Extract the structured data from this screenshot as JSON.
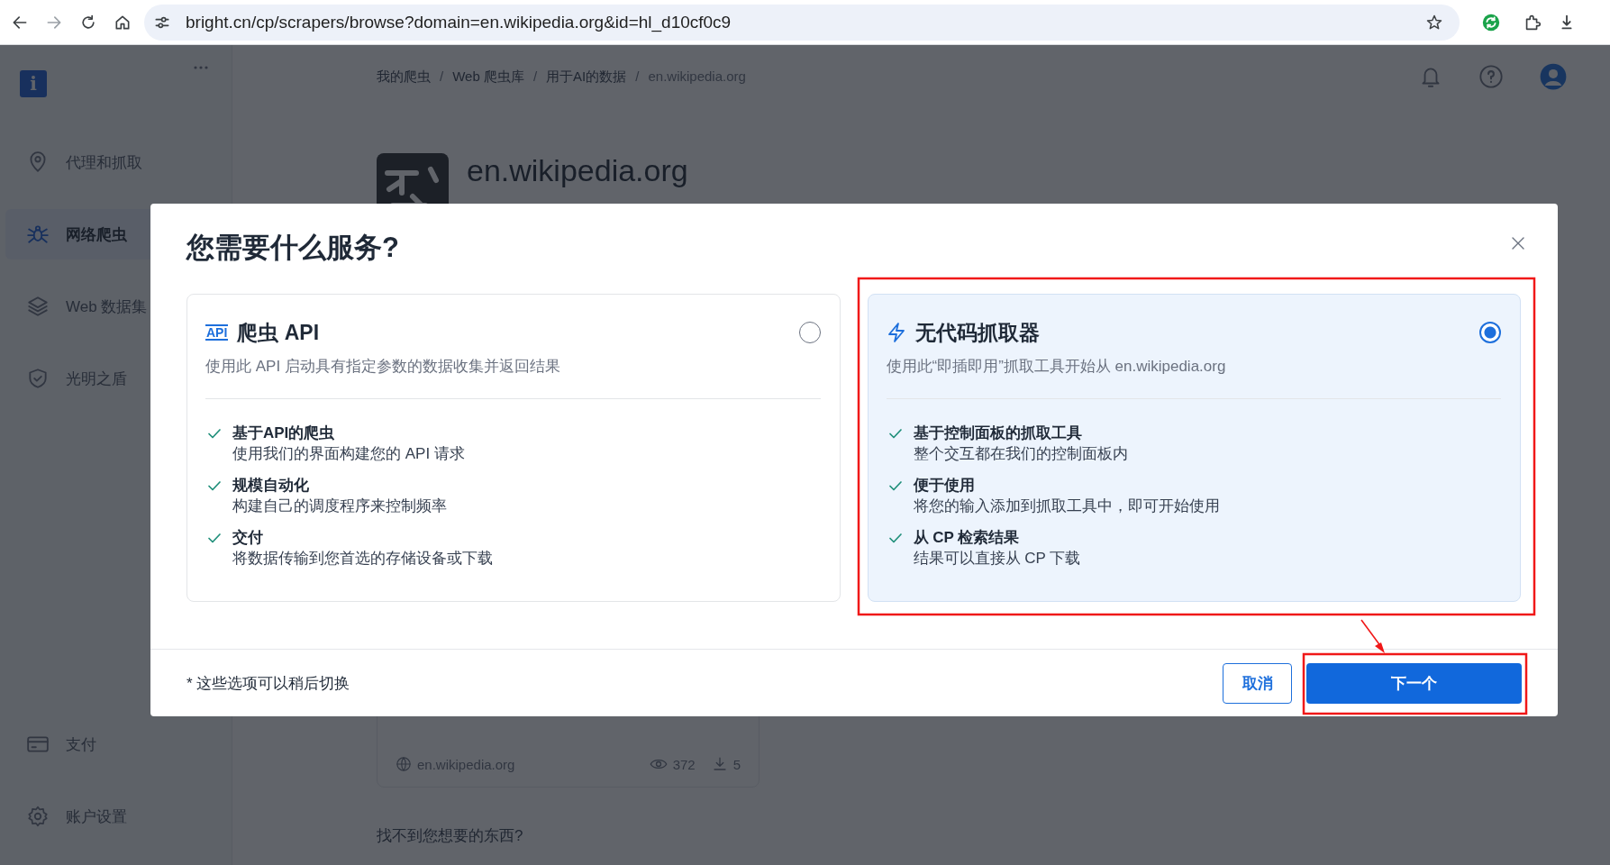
{
  "browser": {
    "url_host": "bright.cn",
    "url_path": "/cp/scrapers/browse?domain=en.wikipedia.org&id=hl_d10cf0c9"
  },
  "sidebar": {
    "logo": "i",
    "items": [
      {
        "kind": "pin",
        "label": "代理和抓取",
        "selected": false
      },
      {
        "kind": "spider",
        "label": "网络爬虫",
        "selected": true
      },
      {
        "kind": "layers",
        "label": "Web 数据集",
        "selected": false
      },
      {
        "kind": "shield",
        "label": "光明之盾",
        "selected": false
      }
    ],
    "bottom_items": [
      {
        "kind": "card",
        "label": "支付",
        "selected": false
      },
      {
        "kind": "gear",
        "label": "账户设置",
        "selected": false
      }
    ]
  },
  "breadcrumbs": {
    "separator": "/",
    "items": [
      {
        "label": "我的爬虫",
        "current": false
      },
      {
        "label": "Web 爬虫库",
        "current": false
      },
      {
        "label": "用于AI的数据",
        "current": false
      },
      {
        "label": "en.wikipedia.org",
        "current": true
      }
    ]
  },
  "page": {
    "title": "en.wikipedia.org"
  },
  "dataset_card": {
    "domain": "en.wikipedia.org",
    "views": "372",
    "downloads": "5"
  },
  "help_text": "找不到您想要的东西?",
  "dialog": {
    "title": "您需要什么服务?",
    "options": [
      {
        "kind": "api",
        "badge": "API",
        "title": "爬虫 API",
        "description": "使用此 API 启动具有指定参数的数据收集并返回结果",
        "selected": false,
        "features": [
          {
            "title": "基于API的爬虫",
            "text": "使用我们的界面构建您的 API 请求"
          },
          {
            "title": "规模自动化",
            "text": "构建自己的调度程序来控制频率"
          },
          {
            "title": "交付",
            "text": "将数据传输到您首选的存储设备或下载"
          }
        ]
      },
      {
        "kind": "bolt",
        "title": "无代码抓取器",
        "description": "使用此“即插即用”抓取工具开始从 en.wikipedia.org",
        "selected": true,
        "features": [
          {
            "title": "基于控制面板的抓取工具",
            "text": "整个交互都在我们的控制面板内"
          },
          {
            "title": "便于使用",
            "text": "将您的输入添加到抓取工具中，即可开始使用"
          },
          {
            "title": "从 CP 检索结果",
            "text": "结果可以直接从 CP 下载"
          }
        ]
      }
    ],
    "footnote": "* 这些选项可以稍后切换",
    "buttons": [
      {
        "kind": "secondary",
        "label": "取消"
      },
      {
        "kind": "primary",
        "label": "下一个"
      }
    ]
  }
}
